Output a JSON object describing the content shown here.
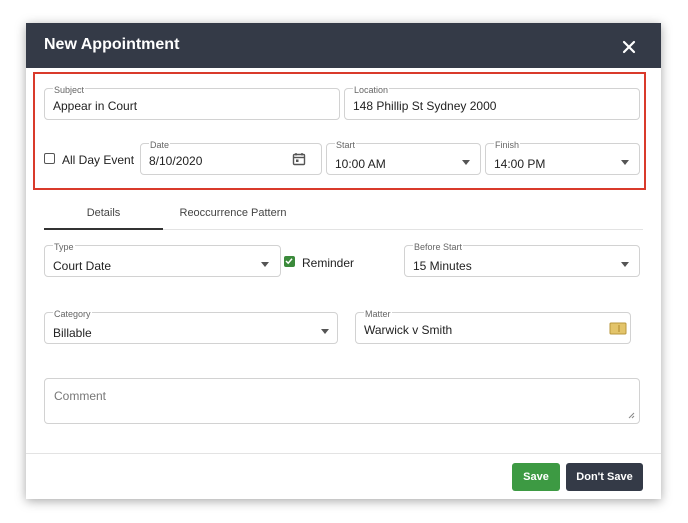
{
  "dialog": {
    "title": "New Appointment",
    "close_icon": "close-icon"
  },
  "subject": {
    "label": "Subject",
    "value": "Appear in Court"
  },
  "location": {
    "label": "Location",
    "value": "148 Phillip St Sydney 2000"
  },
  "all_day": {
    "label": "All Day Event",
    "checked": false
  },
  "date": {
    "label": "Date",
    "value": "8/10/2020",
    "icon": "calendar-icon"
  },
  "start": {
    "label": "Start",
    "value": "10:00 AM"
  },
  "finish": {
    "label": "Finish",
    "value": "14:00 PM"
  },
  "tabs": [
    {
      "label": "Details",
      "active": true
    },
    {
      "label": "Reoccurrence Pattern",
      "active": false
    }
  ],
  "type": {
    "label": "Type",
    "value": "Court Date"
  },
  "reminder": {
    "label": "Reminder",
    "checked": true
  },
  "before_start": {
    "label": "Before Start",
    "value": "15 Minutes"
  },
  "category": {
    "label": "Category",
    "value": "Billable"
  },
  "matter": {
    "label": "Matter",
    "value": "Warwick v Smith",
    "icon": "folder-icon"
  },
  "comment": {
    "placeholder": "Comment"
  },
  "buttons": {
    "save": "Save",
    "dont_save": "Don't Save"
  },
  "colors": {
    "titlebar": "#343a47",
    "highlight": "#d93a2b",
    "save": "#3d9a43",
    "dont_save": "#343a47",
    "checkbox_checked": "#3b8a3b"
  }
}
